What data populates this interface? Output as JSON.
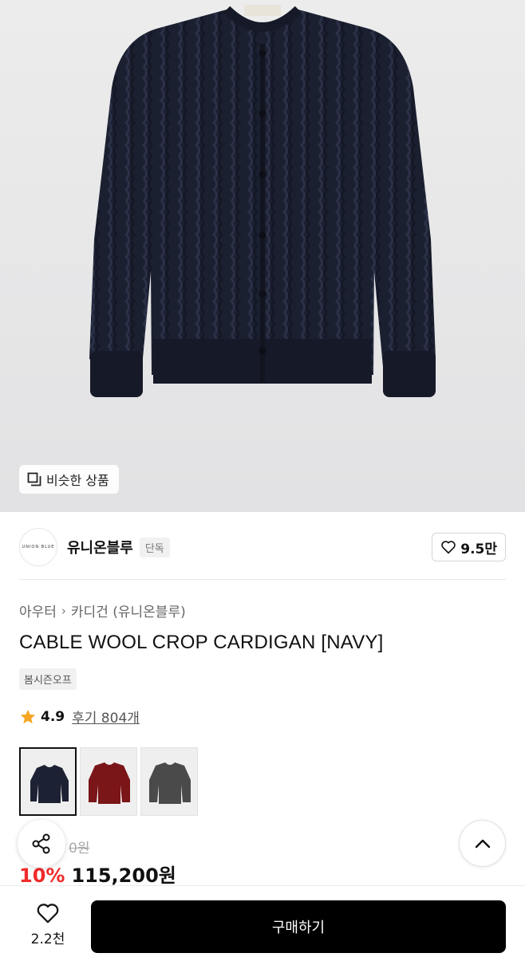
{
  "hero": {
    "similar_label": "비슷한 상품",
    "similar_icon": "stack-icon",
    "product_image": "navy-cable-cardigan"
  },
  "brand": {
    "logo_text": "UNION BLUE",
    "name": "유니온블루",
    "exclusive_badge": "단독",
    "like_count": "9.5만"
  },
  "breadcrumb": {
    "level1": "아우터",
    "level2": "카디건 (유니온블루)"
  },
  "product": {
    "title": "CABLE WOOL CROP CARDIGAN [NAVY]",
    "tag": "봄시즌오프",
    "rating": "4.9",
    "reviews": "후기 804개"
  },
  "swatches": [
    {
      "name": "navy",
      "color": "#1c2233",
      "selected": true
    },
    {
      "name": "red",
      "color": "#7a1518",
      "selected": false
    },
    {
      "name": "gray",
      "color": "#4a4a4a",
      "selected": false
    }
  ],
  "price": {
    "original": "0원",
    "discount": "10%",
    "sale": "115,200원"
  },
  "bottom": {
    "wish_count": "2.2천",
    "buy_label": "구매하기"
  },
  "colors": {
    "discount_red": "#f02b2b",
    "star": "#f5a623",
    "buy_bg": "#000000"
  }
}
